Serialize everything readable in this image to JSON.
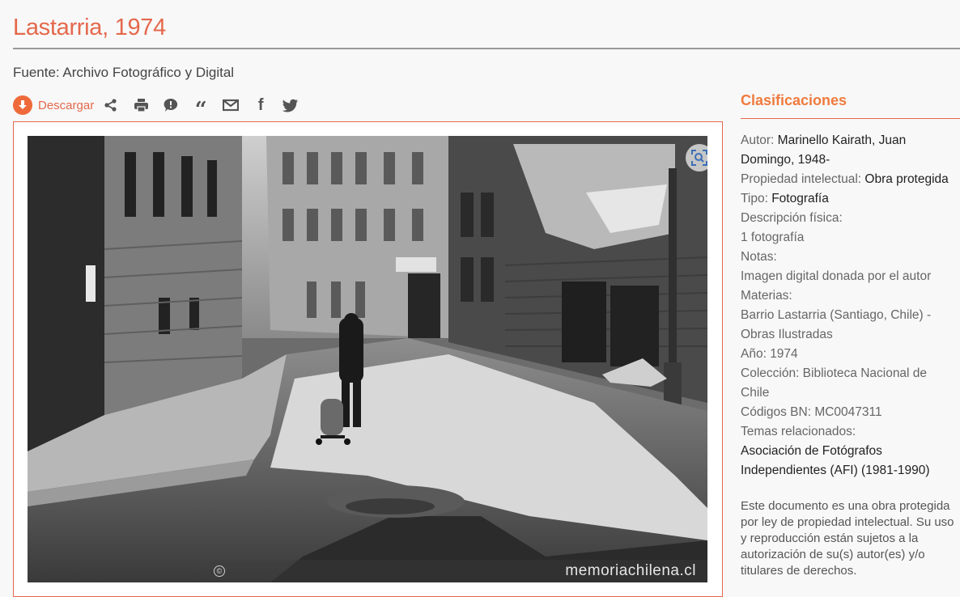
{
  "page": {
    "title": "Lastarria, 1974",
    "source": "Fuente: Archivo Fotográfico y Digital"
  },
  "toolbar": {
    "download_label": "Descargar",
    "icons": [
      "download-icon",
      "share-icon",
      "print-icon",
      "comment-icon",
      "quote-icon",
      "email-icon",
      "facebook-icon",
      "twitter-icon"
    ]
  },
  "image": {
    "watermark": "memoriachilena.cl",
    "copyright_symbol": "©"
  },
  "sidebar": {
    "heading": "Clasificaciones",
    "autor_label": "Autor: ",
    "autor_value": "Marinello Kairath, Juan Domingo, 1948-",
    "propiedad_label": "Propiedad intelectual: ",
    "propiedad_value": "Obra protegida",
    "tipo_label": "Tipo: ",
    "tipo_value": "Fotografía",
    "descripcion_label": "Descripción física:",
    "descripcion_value": "1 fotografía",
    "notas_label": "Notas:",
    "notas_value": "Imagen digital donada por el autor",
    "materias_label": "Materias:",
    "materias_value": "Barrio Lastarria (Santiago, Chile) - Obras Ilustradas",
    "anio": "Año: 1974",
    "coleccion": "Colección: Biblioteca Nacional de Chile",
    "codigos": "Códigos BN: MC0047311",
    "temas_label": "Temas relacionados:",
    "temas_value": "Asociación de Fotógrafos Independientes (AFI) (1981-1990)",
    "notice": "Este documento es una obra protegida por ley de propiedad intelectual. Su uso y reproducción están sujetos a la autorización de su(s) autor(es) y/o titulares de derechos."
  },
  "colors": {
    "accent": "#e4684c",
    "heading_orange": "#ef7a3e",
    "download_orange": "#ef6a3b"
  }
}
